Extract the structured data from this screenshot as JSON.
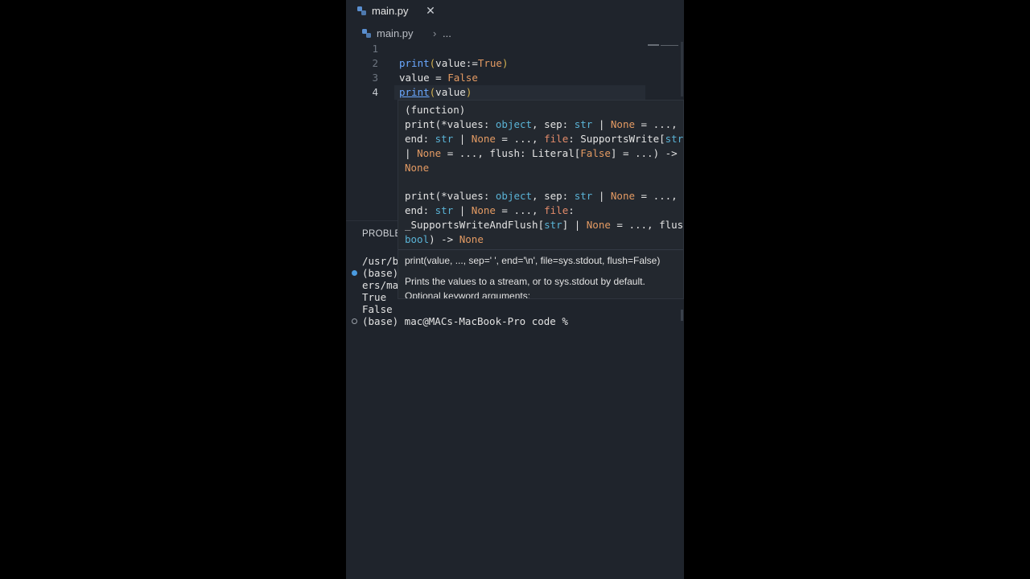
{
  "tab": {
    "filename": "main.py",
    "close_glyph": "✕"
  },
  "toolbar": {
    "run_glyph": "▷",
    "chevron_glyph": "⌄",
    "split_glyph": "◫",
    "more_glyph": "···"
  },
  "breadcrumb": {
    "file": "main.py",
    "separator": "›",
    "more": "..."
  },
  "code": {
    "line_numbers": [
      "1",
      "2",
      "3",
      "4"
    ],
    "line2": {
      "fn": "print",
      "open": "(",
      "arg": "value:=",
      "kw": "True",
      "close": ")"
    },
    "line3": {
      "var": "value = ",
      "kw": "False"
    },
    "line4": {
      "fn": "print",
      "open": "(",
      "arg": "value",
      "close": ")"
    }
  },
  "hover": {
    "kind": "(function)",
    "sig1": {
      "l1_a": "print(*values: ",
      "l1_t1": "object",
      "l1_b": ", sep: ",
      "l1_t2": "str",
      "l1_c": " | ",
      "l1_n": "None",
      "l1_d": " = ...,",
      "l2_a": "end: ",
      "l2_t1": "str",
      "l2_b": " | ",
      "l2_n": "None",
      "l2_c": " = ..., ",
      "l2_f": "file",
      "l2_d": ": SupportsWrite[",
      "l2_t2": "str",
      "l2_e": "]",
      "l3_a": "| ",
      "l3_n": "None",
      "l3_b": " = ..., flush: Literal[",
      "l3_f": "False",
      "l3_c": "] = ...) ->",
      "l4_n": "None"
    },
    "sig2": {
      "l1_a": "print(*values: ",
      "l1_t1": "object",
      "l1_b": ", sep: ",
      "l1_t2": "str",
      "l1_c": " | ",
      "l1_n": "None",
      "l1_d": " = ...,",
      "l2_a": "end: ",
      "l2_t1": "str",
      "l2_b": " | ",
      "l2_n": "None",
      "l2_c": " = ..., ",
      "l2_f": "file",
      "l2_d": ":",
      "l3_a": "_SupportsWriteAndFlush[",
      "l3_t": "str",
      "l3_b": "] | ",
      "l3_n": "None",
      "l3_c": " = ..., flush:",
      "l4_t": "bool",
      "l4_a": ") -> ",
      "l4_n": "None"
    },
    "doc_signature": "print(value, ..., sep=' ', end='\\n', file=sys.stdout, flush=False)",
    "doc_line1": "Prints the values to a stream, or to sys.stdout by default.",
    "doc_line2": "Optional keyword arguments:"
  },
  "panel": {
    "tab_label": "PROBLE",
    "terminal": [
      "/usr/b",
      "(base)",
      "ers/ma",
      "True",
      "False",
      "(base) mac@MACs-MacBook-Pro code %"
    ]
  },
  "colors": {
    "accent": "#6aa8ff",
    "keyword": "#e39a63",
    "type": "#5ab3d6",
    "background": "#1f242c",
    "status_dot": "#4a9be0"
  }
}
